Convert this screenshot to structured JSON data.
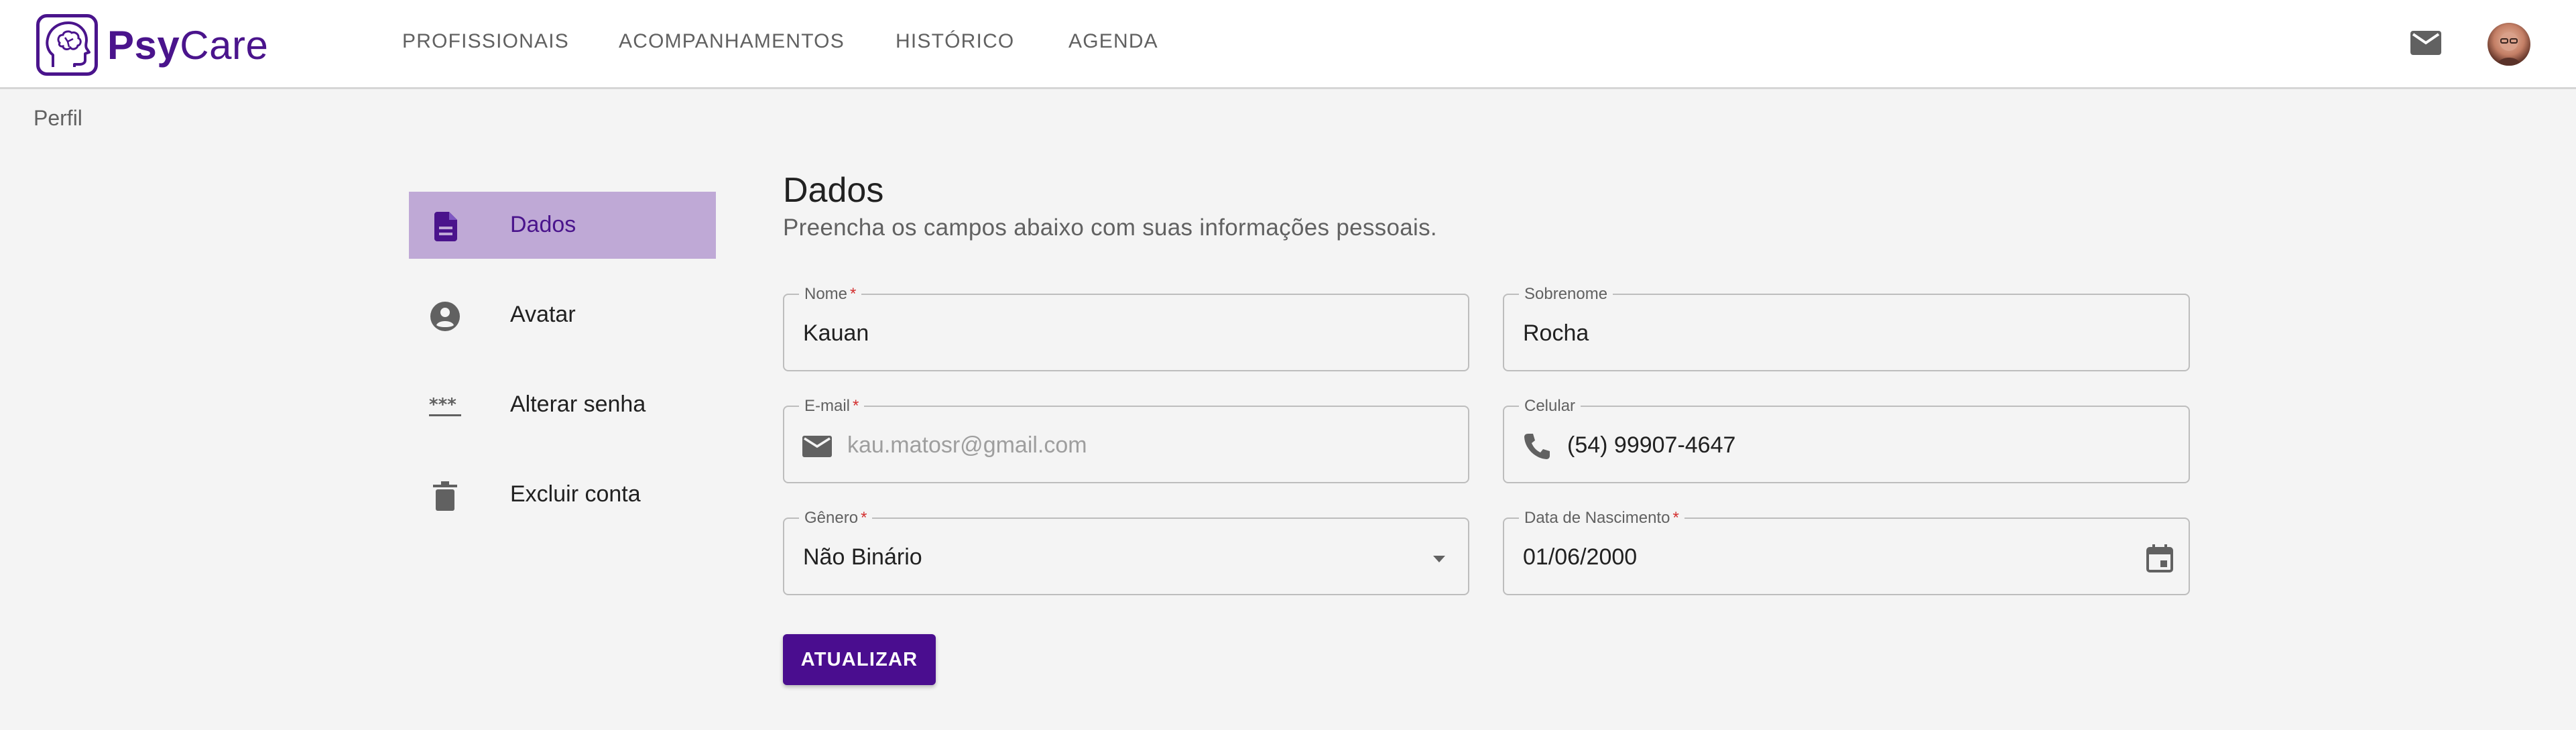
{
  "brand": {
    "name_bold": "Psy",
    "name_light": "Care"
  },
  "nav": {
    "items": [
      {
        "label": "PROFISSIONAIS"
      },
      {
        "label": "ACOMPANHAMENTOS"
      },
      {
        "label": "HISTÓRICO"
      },
      {
        "label": "AGENDA"
      }
    ]
  },
  "header": {
    "mail_icon": "mail-icon",
    "avatar": "user-avatar"
  },
  "breadcrumb": {
    "label": "Perfil"
  },
  "sidebar": {
    "items": [
      {
        "label": "Dados",
        "icon": "document-icon",
        "active": true
      },
      {
        "label": "Avatar",
        "icon": "account-circle-icon",
        "active": false
      },
      {
        "label": "Alterar senha",
        "icon": "password-icon",
        "active": false
      },
      {
        "label": "Excluir conta",
        "icon": "trash-icon",
        "active": false
      }
    ]
  },
  "form": {
    "title": "Dados",
    "subtitle": "Preencha os campos abaixo com suas informações pessoais.",
    "fields": {
      "nome": {
        "label": "Nome",
        "required": "*",
        "value": "Kauan"
      },
      "sobrenome": {
        "label": "Sobrenome",
        "value": "Rocha"
      },
      "email": {
        "label": "E-mail",
        "required": "*",
        "value": "kau.matosr@gmail.com",
        "icon": "mail-icon",
        "disabled": true
      },
      "celular": {
        "label": "Celular",
        "value": "(54) 99907-4647",
        "icon": "phone-icon"
      },
      "genero": {
        "label": "Gênero",
        "required": "*",
        "value": "Não Binário",
        "icon": "dropdown-arrow-icon"
      },
      "nascimento": {
        "label": "Data de Nascimento",
        "required": "*",
        "value": "01/06/2000",
        "icon": "calendar-icon"
      }
    },
    "submit_label": "ATUALIZAR"
  },
  "colors": {
    "primary": "#4a148c",
    "active_bg": "#bfa9d6",
    "background": "#f4f4f4",
    "required": "#d32f2f"
  }
}
